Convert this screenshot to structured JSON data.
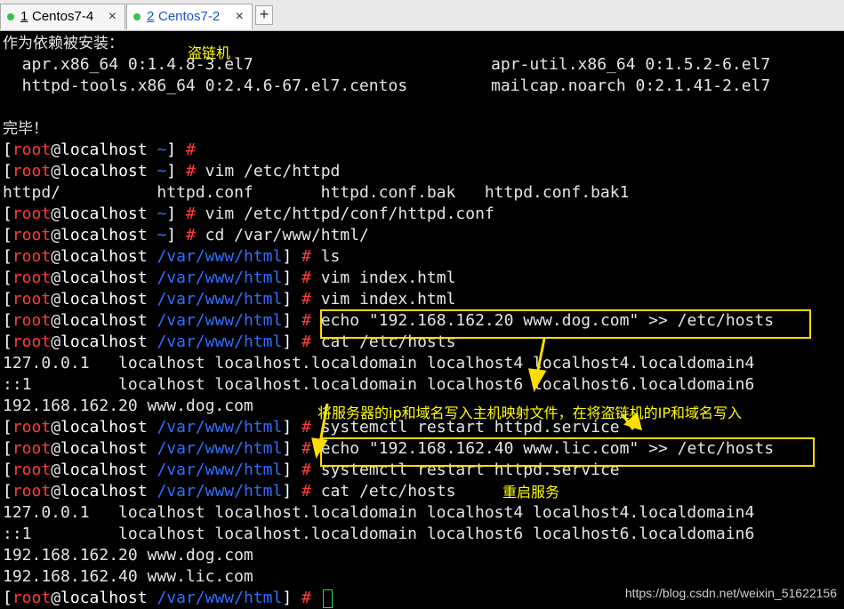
{
  "tabs": [
    {
      "num": "1",
      "name": "Centos7-4",
      "close": "×"
    },
    {
      "num": "2",
      "name": "Centos7-2",
      "close": "×"
    }
  ],
  "new_tab_label": "+",
  "prompt": {
    "user": "root",
    "at": "@",
    "host": "localhost",
    "home": "~",
    "html_dir": "/var/www/html",
    "hash": "#"
  },
  "terminal": {
    "deps_header": "作为依赖被安装：",
    "dep1_left": "  apr.x86_64 0:1.4.8-3.el7",
    "dep1_right": "apr-util.x86_64 0:1.5.2-6.el7",
    "dep2_left": "  httpd-tools.x86_64 0:2.4.6-67.el7.centos",
    "dep2_right": "mailcap.noarch 0:2.1.41-2.el7",
    "done": "完毕！",
    "cmd_vim_httpd": "vim /etc/httpd",
    "tab_completion": "httpd/          httpd.conf       httpd.conf.bak   httpd.conf.bak1",
    "cmd_vim_conf": "vim /etc/httpd/conf/httpd.conf",
    "cmd_cd": "cd /var/www/html/",
    "cmd_ls": "ls",
    "cmd_vim_index": "vim index.html",
    "cmd_echo_dog": "echo \"192.168.162.20 www.dog.com\" >> /etc/hosts",
    "cmd_cat_hosts": "cat /etc/hosts",
    "hosts_line1": "127.0.0.1   localhost localhost.localdomain localhost4 localhost4.localdomain4",
    "hosts_line2": "::1         localhost localhost.localdomain localhost6 localhost6.localdomain6",
    "hosts_dog": "192.168.162.20 www.dog.com",
    "cmd_restart": "systemctl restart httpd.service",
    "cmd_echo_lic": "echo \"192.168.162.40 www.lic.com\" >> /etc/hosts",
    "hosts_lic": "192.168.162.40 www.lic.com"
  },
  "annotations": {
    "hotlink_machine": "盗链机",
    "write_hosts_note": "将服务器的ip和域名写入主机映射文件，在将盗链机的IP和域名写入",
    "restart_service": "重启服务",
    "color": "#ffff00"
  },
  "watermark": "https://blog.csdn.net/weixin_51622156",
  "colors": {
    "user": "#ff3b3b",
    "path": "#2f6fff",
    "box": "#ffdd00",
    "cursor": "#39d353",
    "active_tab_text": "#1a55c9"
  }
}
